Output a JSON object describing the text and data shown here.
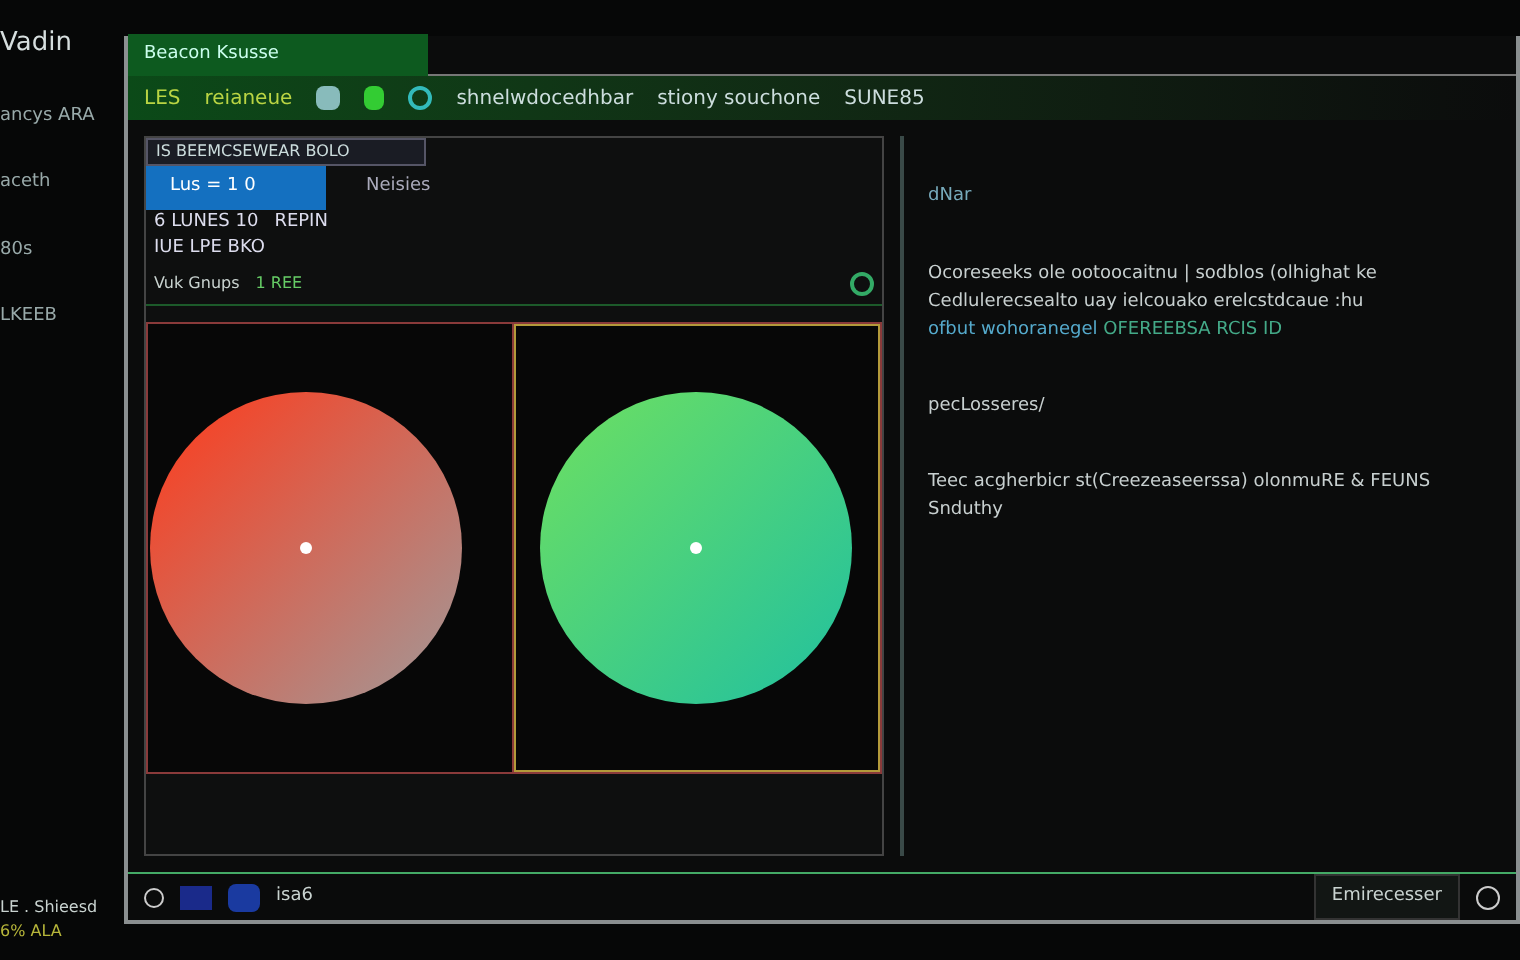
{
  "sidebar": {
    "title": "Vadin",
    "items": [
      "ancys ARA",
      "aceth",
      "80s",
      "LKEEB"
    ],
    "footer": [
      "LE . Shieesd",
      "6% ALA"
    ]
  },
  "window": {
    "title": "Beacon Ksusse"
  },
  "toolbar": {
    "items": [
      "LES",
      "reianeue"
    ],
    "breadcrumb": [
      "shnelwdocedhbar",
      "stiony souchone",
      "SUNE85"
    ]
  },
  "left_panel": {
    "dropdown": "IS BEEMCSEWEAR BOLO",
    "tabs": [
      {
        "label": "Lus = 1 0",
        "selected": true
      },
      {
        "label": "Neisies",
        "selected": false
      }
    ],
    "info": [
      "6 LUNES 10",
      "REPIN",
      "IUE LPE BKO"
    ],
    "filter": {
      "label": "Vuk Gnups",
      "value": "1 REE"
    }
  },
  "right_panel": {
    "heading": "dNar",
    "paragraphs": [
      {
        "text": "Ocoreseeks ole ootoocaitnu | sodblos (olhighat ke Cedlulerecsealto uay ielcouako erelcstdcaue :hu",
        "link": "ofbut wohoranegel",
        "tail": "OFEREEBSA RCIS ID"
      },
      {
        "text": "pecLosseres/"
      },
      {
        "text": "Teec acgherbicr st(Creezeaseerssa) olonmuRE & FEUNS Snduthy"
      }
    ]
  },
  "status_bar": {
    "left": "isa6",
    "right": "Emirecesser"
  }
}
